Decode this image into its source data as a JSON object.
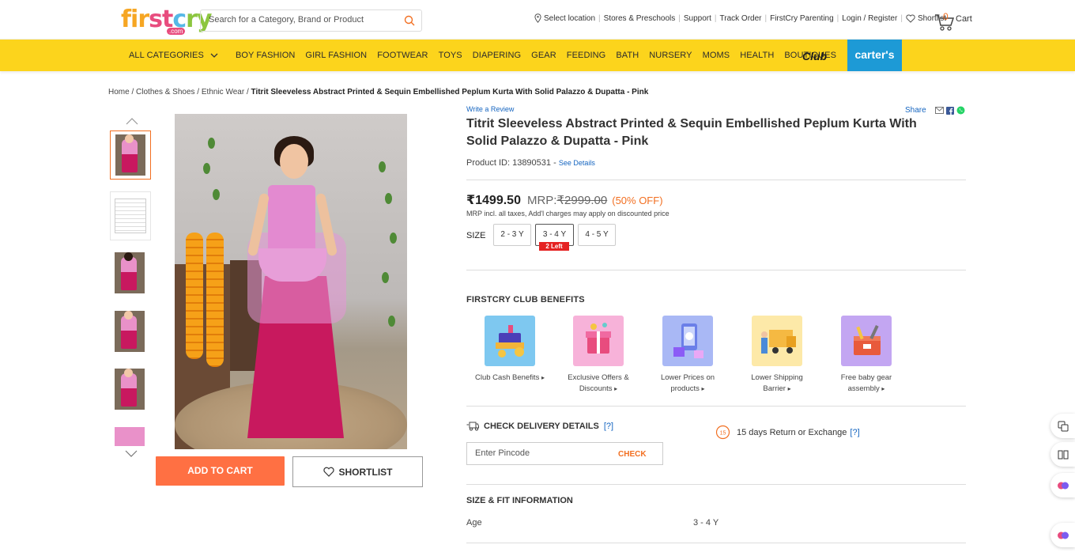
{
  "header": {
    "logo_text": "firstcry",
    "logo_sub": ".com",
    "search_placeholder": "Search for a Category, Brand or Product",
    "links": [
      "Select location",
      "Stores & Preschools",
      "Support",
      "Track Order",
      "FirstCry Parenting",
      "Login / Register",
      "Shortlist"
    ],
    "cart_count": "0",
    "cart_label": "Cart"
  },
  "nav": {
    "items": [
      "ALL CATEGORIES",
      "BOY FASHION",
      "GIRL FASHION",
      "FOOTWEAR",
      "TOYS",
      "DIAPERING",
      "GEAR",
      "FEEDING",
      "BATH",
      "NURSERY",
      "MOMS",
      "HEALTH",
      "BOUTIQUES"
    ],
    "club": "Club",
    "carters": "carter's"
  },
  "breadcrumb": {
    "items": [
      "Home",
      "Clothes & Shoes",
      "Ethnic Wear"
    ],
    "current": "Titrit Sleeveless Abstract Printed & Sequin Embellished Peplum Kurta With Solid Palazzo & Dupatta - Pink"
  },
  "product": {
    "write_review": "Write a Review",
    "share": "Share",
    "title": "Titrit Sleeveless Abstract Printed & Sequin Embellished Peplum Kurta With Solid Palazzo & Dupatta - Pink",
    "product_id_label": "Product ID: 13890531 -",
    "see_details": "See Details",
    "price": "₹1499.50",
    "mrp_label": "MRP:",
    "mrp": "₹2999.00",
    "discount": "(50% OFF)",
    "price_note": "MRP incl. all taxes, Add'l charges may apply on discounted price",
    "size_label": "SIZE",
    "sizes": [
      "2 - 3 Y",
      "3 - 4 Y",
      "4 - 5 Y"
    ],
    "selected_size": "3 - 4 Y",
    "stock_badge": "2 Left",
    "add_to_cart": "ADD TO CART",
    "shortlist": "SHORTLIST"
  },
  "club": {
    "title": "FIRSTCRY CLUB BENEFITS",
    "benefits": [
      {
        "line1": "Club Cash Benefits",
        "line2": "",
        "color": "#7ec8f0"
      },
      {
        "line1": "Exclusive Offers &",
        "line2": "Discounts",
        "color": "#f7b2d9"
      },
      {
        "line1": "Lower Prices on",
        "line2": "products",
        "color": "#a9b8f5"
      },
      {
        "line1": "Lower Shipping",
        "line2": "Barrier",
        "color": "#fde9a8"
      },
      {
        "line1": "Free baby gear",
        "line2": "assembly",
        "color": "#c3a6f2"
      }
    ]
  },
  "delivery": {
    "title": "CHECK DELIVERY DETAILS",
    "help": "[?]",
    "pincode_placeholder": "Enter Pincode",
    "check": "CHECK",
    "return_days": "15",
    "return_text": "15 days Return or Exchange",
    "return_help": "[?]"
  },
  "size_fit": {
    "title": "SIZE & FIT INFORMATION",
    "age_label": "Age",
    "age_value": "3 - 4 Y"
  },
  "colors": {
    "nav_bg": "#fcd41c",
    "accent": "#ff7043",
    "link": "#1565c0",
    "carters": "#1d9ad6"
  }
}
